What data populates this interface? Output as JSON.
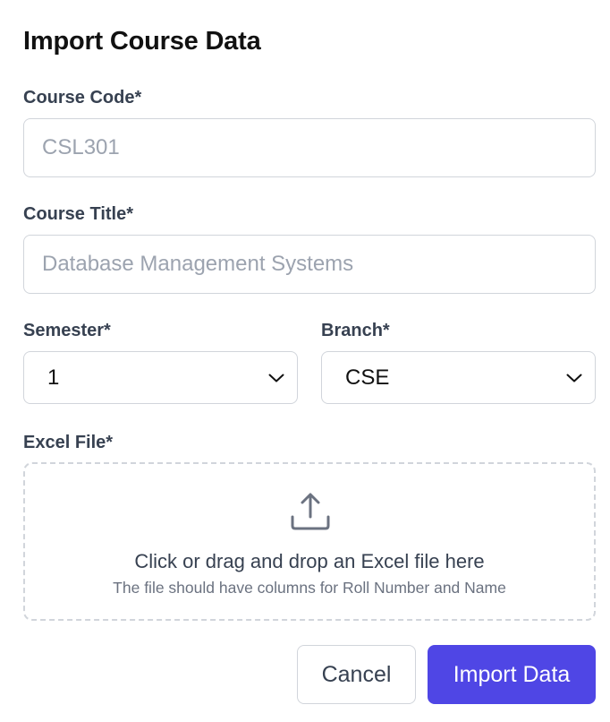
{
  "dialog": {
    "title": "Import Course Data"
  },
  "form": {
    "course_code": {
      "label": "Course Code*",
      "value": "",
      "placeholder": "CSL301"
    },
    "course_title": {
      "label": "Course Title*",
      "value": "",
      "placeholder": "Database Management Systems"
    },
    "semester": {
      "label": "Semester*",
      "selected": "1"
    },
    "branch": {
      "label": "Branch*",
      "selected": "CSE"
    },
    "excel_file": {
      "label": "Excel File*",
      "drop_text": "Click or drag and drop an Excel file here",
      "hint": "The file should have columns for Roll Number and Name",
      "icon": "upload-icon"
    }
  },
  "actions": {
    "cancel_label": "Cancel",
    "submit_label": "Import Data"
  },
  "colors": {
    "primary": "#4f46e5",
    "border": "#d1d5db",
    "label": "#374151",
    "placeholder": "#9ca3af",
    "muted": "#6b7280"
  }
}
